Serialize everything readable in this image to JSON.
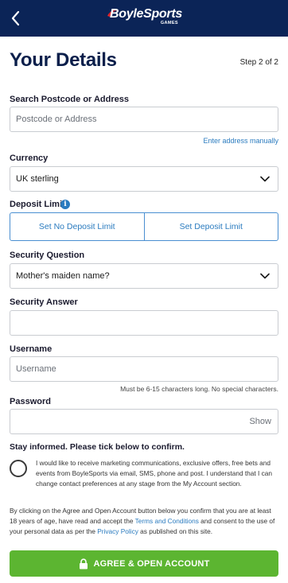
{
  "brand": {
    "name": "BoyleSports",
    "sub": "GAMES"
  },
  "header": {
    "title": "Your Details",
    "step": "Step 2 of 2"
  },
  "address": {
    "label": "Search Postcode or Address",
    "placeholder": "Postcode or Address",
    "manual_link": "Enter address manually"
  },
  "currency": {
    "label": "Currency",
    "value": "UK sterling"
  },
  "deposit": {
    "label": "Deposit Limit",
    "no_limit": "Set No Deposit Limit",
    "set_limit": "Set Deposit Limit"
  },
  "security_question": {
    "label": "Security Question",
    "value": "Mother's maiden name?"
  },
  "security_answer": {
    "label": "Security Answer",
    "value": ""
  },
  "username": {
    "label": "Username",
    "placeholder": "Username",
    "hint": "Must be 6-15 characters long. No special characters."
  },
  "password": {
    "label": "Password",
    "show": "Show"
  },
  "consent": {
    "heading": "Stay informed. Please tick below to confirm.",
    "text": "I would like to receive marketing communications, exclusive offers, free bets and events from BoyleSports via email, SMS, phone and post. I understand that I can change contact preferences at any stage from the My Account section."
  },
  "legal": {
    "part1": "By clicking on the Agree and Open Account button below you confirm that you are at least 18 years of age, have read and accept the ",
    "terms_link": "Terms and Conditions",
    "part2": " and consent to the use of your personal data as per the ",
    "privacy_link": "Privacy Policy",
    "part3": " as published on this site."
  },
  "submit": {
    "label": "AGREE & OPEN ACCOUNT"
  },
  "colors": {
    "navy": "#0b2457",
    "link_blue": "#2a7bbf",
    "button_green": "#5cb531",
    "logo_red": "#e4262c"
  },
  "icons": {
    "back": "chevron-left-icon",
    "info": "info-icon",
    "select": "chevron-down-icon",
    "lock": "lock-icon"
  }
}
